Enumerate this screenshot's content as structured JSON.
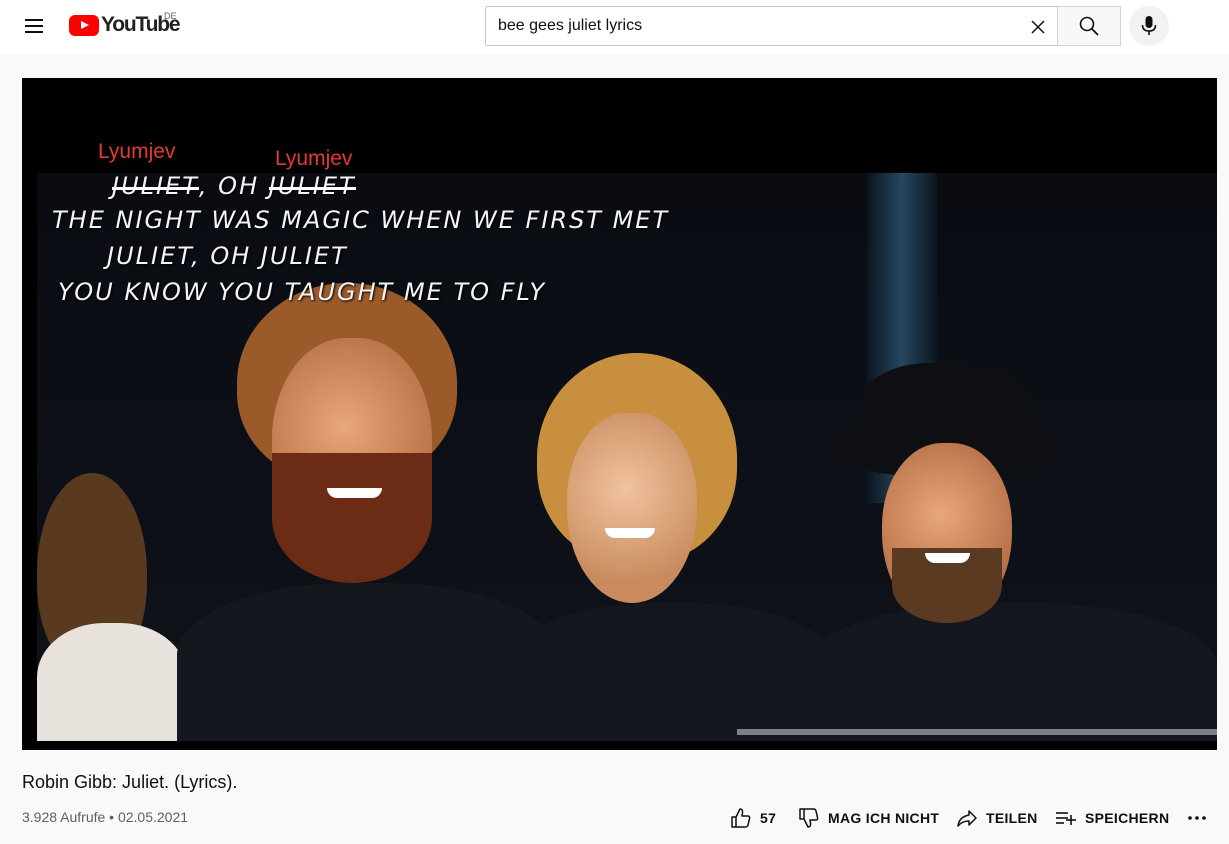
{
  "header": {
    "logo_text": "YouTube",
    "country_code": "DE",
    "search": {
      "value": "bee gees juliet lyrics"
    }
  },
  "video": {
    "lyrics": {
      "annotation_1": "Lyumjev",
      "annotation_2": "Lyumjev",
      "line1_word1": "JULIET",
      "line1_mid": ", OH ",
      "line1_word2": "JULIET",
      "line2": "THE NIGHT WAS MAGIC WHEN WE FIRST MET",
      "line3": "JULIET, OH JULIET",
      "line4": "YOU KNOW YOU TAUGHT ME TO FLY"
    }
  },
  "title": "Robin Gibb: Juliet. (Lyrics).",
  "meta": "3.928 Aufrufe • 02.05.2021",
  "actions": {
    "like_count": "57",
    "dislike_label": "MAG ICH NICHT",
    "share_label": "TEILEN",
    "save_label": "SPEICHERN"
  },
  "colors": {
    "brand_red": "#ff0000",
    "annotation_red": "#e53935",
    "text_primary": "#0f0f0f",
    "text_secondary": "#606060"
  }
}
